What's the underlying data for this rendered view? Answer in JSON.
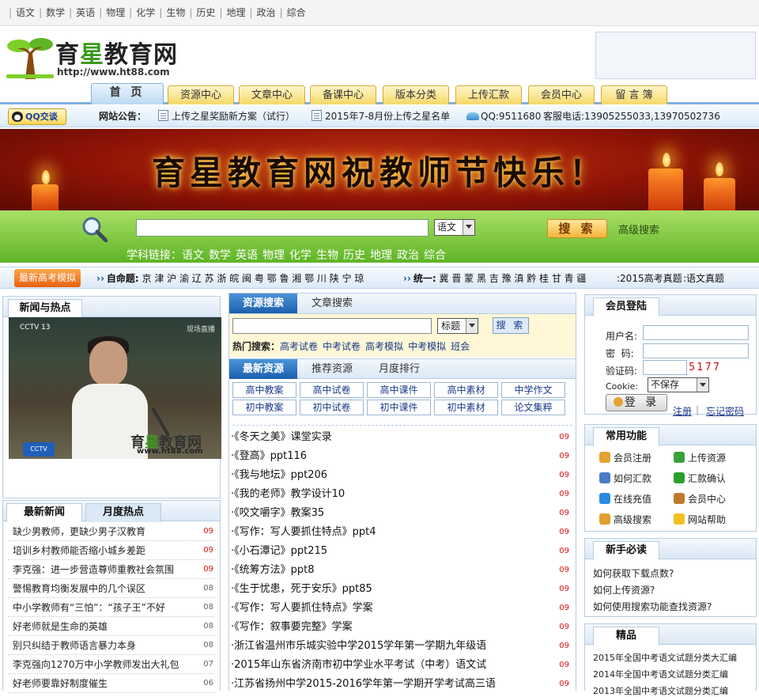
{
  "topbar": {
    "subjects": [
      "语文",
      "数学",
      "英语",
      "物理",
      "化学",
      "生物",
      "历史",
      "地理",
      "政治",
      "综合"
    ]
  },
  "logo": {
    "name_part1": "育",
    "name_star": "星",
    "name_part2": "教育网",
    "url": "http://www.ht88.com"
  },
  "nav": {
    "tabs": [
      "首 页",
      "资源中心",
      "文章中心",
      "备课中心",
      "版本分类",
      "上传汇款",
      "会员中心",
      "留 言 簿"
    ]
  },
  "notice": {
    "qq_button": "QQ交谈",
    "label": "网站公告：",
    "item1": "上传之星奖励新方案（试行）",
    "item2": "2015年7-8月份上传之星名单",
    "qq": "QQ:9511680",
    "phone": "客服电话:13905255033,13970502736"
  },
  "banner": {
    "title": "育星教育网祝教师节快乐！"
  },
  "search": {
    "select_value": "语文",
    "button": "搜 索",
    "advanced": "高级搜索",
    "sublinks_label": "学科链接：",
    "sublinks": [
      "语文",
      "数学",
      "英语",
      "物理",
      "化学",
      "生物",
      "历史",
      "地理",
      "政治",
      "综合"
    ]
  },
  "exam": {
    "button": "最新高考模拟",
    "auto_label": "自命题:",
    "auto_provinces": "京 津 沪 渝 辽 苏 浙 皖 闽 粤 鄂 鲁 湘 鄂 川 陕 宁 琼",
    "unified_label": "统一:",
    "unified_provinces": "冀 晋 蒙 黑 吉 豫 滇 黔 桂 甘 青 疆",
    "link1": ":2015高考真题",
    "link2": ":语文真题"
  },
  "left": {
    "news_hot_title": "新闻与热点",
    "video": {
      "channel": "CCTV 13",
      "live": "现场直播",
      "logo_part1": "育",
      "logo_star": "星",
      "logo_part2": "教育网",
      "logo_url": "www.ht88.com",
      "badge": "CCTV NEWS"
    },
    "tabs": [
      "最新新闻",
      "月度热点"
    ],
    "news": [
      {
        "title": "缺少男教师，更缺少男子汉教育",
        "date": "09",
        "color": "red"
      },
      {
        "title": "培训乡村教师能否缩小城乡差距",
        "date": "09",
        "color": "red"
      },
      {
        "title": "李克强：进一步营造尊师重教社会氛围",
        "date": "09",
        "color": "red"
      },
      {
        "title": "警惕教育均衡发展中的几个误区",
        "date": "08",
        "color": "gray"
      },
      {
        "title": "中小学教师有“三怕”：“孩子王”不好",
        "date": "08",
        "color": "gray"
      },
      {
        "title": "好老师就是生命的英雄",
        "date": "08",
        "color": "gray"
      },
      {
        "title": "别只纠结于教师语言暴力本身",
        "date": "08",
        "color": "gray"
      },
      {
        "title": "李克强向1270万中小学教师发出大礼包",
        "date": "07",
        "color": "gray"
      },
      {
        "title": "好老师要靠好制度催生",
        "date": "06",
        "color": "gray"
      }
    ]
  },
  "center": {
    "tabs_top": [
      "资源搜索",
      "文章搜索"
    ],
    "select_value": "标题",
    "search_button": "搜 索",
    "hot_label": "热门搜索：",
    "hot": [
      "高考试卷",
      "中考试卷",
      "高考模拟",
      "中考模拟",
      "班会"
    ],
    "tabs_mid": [
      "最新资源",
      "推荐资源",
      "月度排行"
    ],
    "cats_row1": [
      "高中教案",
      "高中试卷",
      "高中课件",
      "高中素材",
      "中学作文"
    ],
    "cats_row2": [
      "初中教案",
      "初中试卷",
      "初中课件",
      "初中素材",
      "论文集粹"
    ],
    "resources": [
      {
        "title": "·《冬天之美》课堂实录",
        "date": "09"
      },
      {
        "title": "·《登高》ppt116",
        "date": "09"
      },
      {
        "title": "·《我与地坛》ppt206",
        "date": "09"
      },
      {
        "title": "·《我的老师》教学设计10",
        "date": "09"
      },
      {
        "title": "·《咬文嚼字》教案35",
        "date": "09"
      },
      {
        "title": "·《写作：写人要抓住特点》ppt4",
        "date": "09"
      },
      {
        "title": "·《小石潭记》ppt215",
        "date": "09"
      },
      {
        "title": "·《统筹方法》ppt8",
        "date": "09"
      },
      {
        "title": "·《生于忧患，死于安乐》ppt85",
        "date": "09"
      },
      {
        "title": "·《写作：写人要抓住特点》学案",
        "date": "09"
      },
      {
        "title": "·《写作：叙事要完整》学案",
        "date": "09"
      },
      {
        "title": "·浙江省温州市乐城实验中学2015学年第一学期九年级语",
        "date": "09"
      },
      {
        "title": "·2015年山东省济南市初中学业水平考试（中考）语文试",
        "date": "09"
      },
      {
        "title": "·江苏省扬州中学2015-2016学年第一学期开学考试高三语",
        "date": "09"
      }
    ]
  },
  "right": {
    "login": {
      "title": "会员登陆",
      "user_label": "用户名:",
      "pass_label": "密  码:",
      "code_label": "验证码:",
      "captcha": "5177",
      "cookie_label": "Cookie:",
      "cookie_value": "不保存",
      "login_button": "登 录",
      "register": "注册",
      "forgot": "忘记密码"
    },
    "func": {
      "title": "常用功能",
      "items": [
        "会员注册",
        "上传资源",
        "如何汇款",
        "汇款确认",
        "在线充值",
        "会员中心",
        "高级搜索",
        "网站帮助"
      ]
    },
    "guide": {
      "title": "新手必读",
      "items": [
        "如何获取下载点数?",
        "如何上传资源?",
        "如何使用搜索功能查找资源?"
      ]
    },
    "best": {
      "title": "精品",
      "items": [
        "2015年全国中考语文试题分类大汇编",
        "2014年全国中考语文试题分类汇编",
        "2013年全国中考语文试题分类汇编"
      ]
    }
  },
  "colors": {
    "accent_blue": "#1c5fae",
    "banner_red": "#8e1306",
    "search_green": "#5fb526",
    "date_red": "#e01010"
  }
}
